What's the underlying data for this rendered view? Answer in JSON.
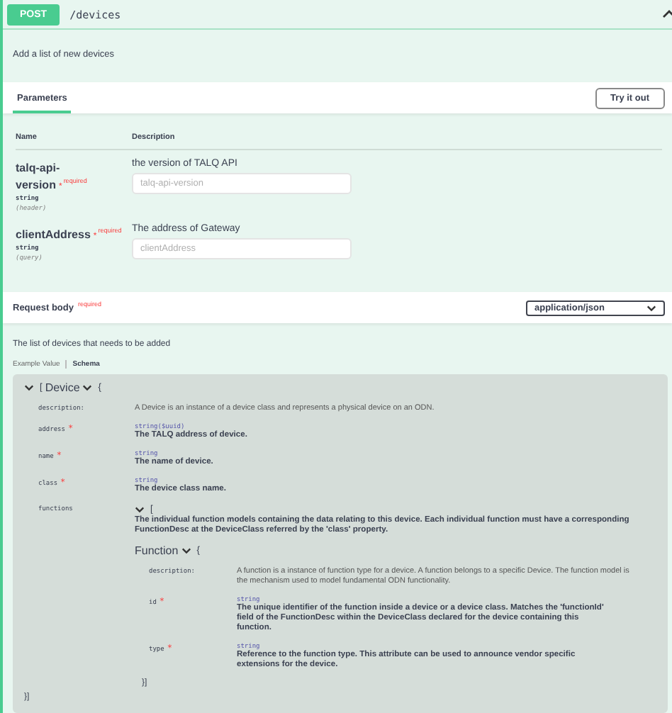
{
  "operation": {
    "method": "POST",
    "path": "/devices",
    "expanded": true,
    "summary": "Add a list of new devices"
  },
  "parameters": {
    "tabs": [
      {
        "label": "Parameters",
        "selected": true
      }
    ],
    "try_button": "Try it out",
    "columns": [
      "Name",
      "Description"
    ],
    "rows": [
      {
        "name": "talq-api-version",
        "required_mark": "*",
        "required_label": "required",
        "type": "string",
        "location": "(header)",
        "description": "the version of TALQ API",
        "placeholder": "talq-api-version"
      },
      {
        "name": "clientAddress",
        "required_mark": "*",
        "required_label": "required",
        "type": "string",
        "location": "(query)",
        "description": "The address of Gateway",
        "placeholder": "clientAddress"
      }
    ]
  },
  "request_body": {
    "title": "Request body",
    "required_label": "required",
    "content_type": "application/json",
    "description": "The list of devices that needs to be added",
    "view_tabs": [
      {
        "label": "Example Value",
        "selected": false
      },
      {
        "label": "Schema",
        "selected": true
      }
    ]
  },
  "schema": {
    "expanded": true,
    "array_open": "[",
    "model": "Device",
    "object_open": "{",
    "description_label": "description:",
    "description": "A Device is an instance of a device class and represents a physical device on an ODN.",
    "properties": [
      {
        "kind": "field",
        "name": "address",
        "required_mark": "*",
        "type": "string($uuid)",
        "description": "The TALQ address of device."
      },
      {
        "kind": "field",
        "name": "name",
        "required_mark": "*",
        "type": "string",
        "description": "The name of device."
      },
      {
        "kind": "field",
        "name": "class",
        "required_mark": "*",
        "type": "string",
        "description": "The device class name."
      },
      {
        "kind": "array",
        "name": "functions",
        "array_open": "[",
        "description": "The individual function models containing the data relating to this device. Each individual function must have a corresponding FunctionDesc at the DeviceClass referred by the 'class' property.",
        "item": {
          "model": "Function",
          "object_open": "{",
          "description_label": "description:",
          "description": "A function is a instance of function type for a device. A function belongs to a specific Device. The function model is the mechanism used to model fundamental ODN functionality.",
          "properties": [
            {
              "kind": "field",
              "name": "id",
              "required_mark": "*",
              "type": "string",
              "description": "The unique identifier of the function inside a device or a device class. Matches the 'functionId' field of the FunctionDesc within the DeviceClass declared for the device containing this function."
            },
            {
              "kind": "field",
              "name": "type",
              "required_mark": "*",
              "type": "string",
              "description": "Reference to the function type. This attribute can be used to announce vendor specific extensions for the device."
            }
          ],
          "close": "}]"
        }
      }
    ],
    "close": "}]"
  }
}
